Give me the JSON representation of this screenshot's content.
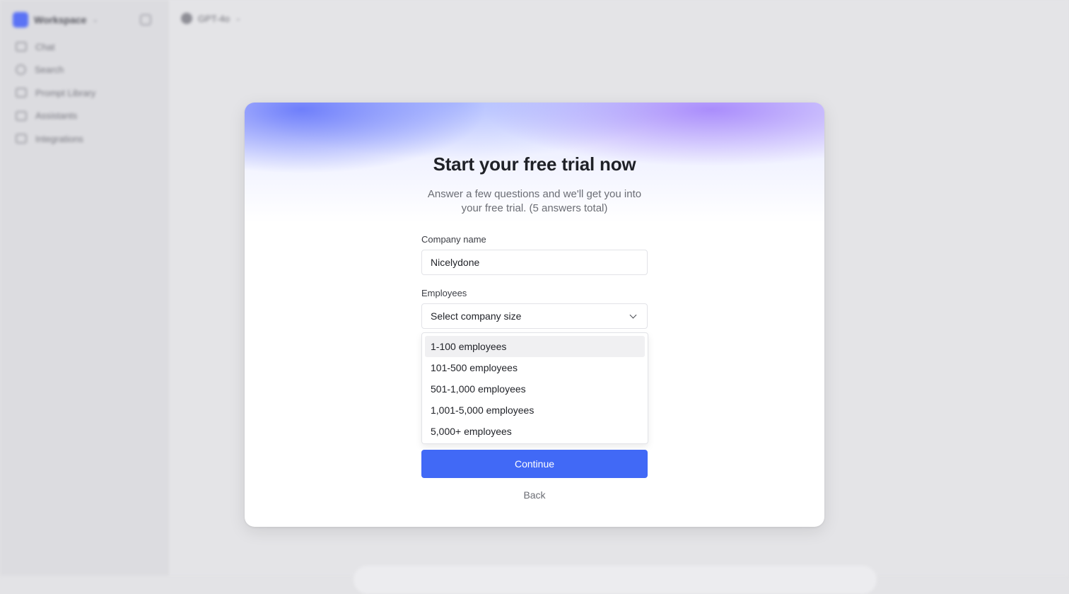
{
  "background": {
    "sidebar": {
      "workspace_name": "Workspace",
      "items": [
        {
          "label": "Chat",
          "icon": "chat-icon"
        },
        {
          "label": "Search",
          "icon": "search-icon"
        },
        {
          "label": "Prompt Library",
          "icon": "library-icon"
        },
        {
          "label": "Assistants",
          "icon": "assistant-icon"
        },
        {
          "label": "Integrations",
          "icon": "integrations-icon"
        }
      ]
    },
    "model_selector": {
      "label": "GPT-4o"
    }
  },
  "modal": {
    "title": "Start your free trial now",
    "subtitle": "Answer a few questions and we'll get you into your free trial. (5 answers total)",
    "company_field": {
      "label": "Company name",
      "value": "Nicelydone"
    },
    "employees_field": {
      "label": "Employees",
      "placeholder": "Select company size",
      "options": [
        "1-100 employees",
        "101-500 employees",
        "501-1,000 employees",
        "1,001-5,000 employees",
        "5,000+ employees"
      ],
      "highlighted_option": "1-100 employees"
    },
    "continue_label": "Continue",
    "back_label": "Back"
  },
  "colors": {
    "accent": "#4169f6",
    "glow_blue": "#5c6efa",
    "glow_purple": "#966efa"
  }
}
